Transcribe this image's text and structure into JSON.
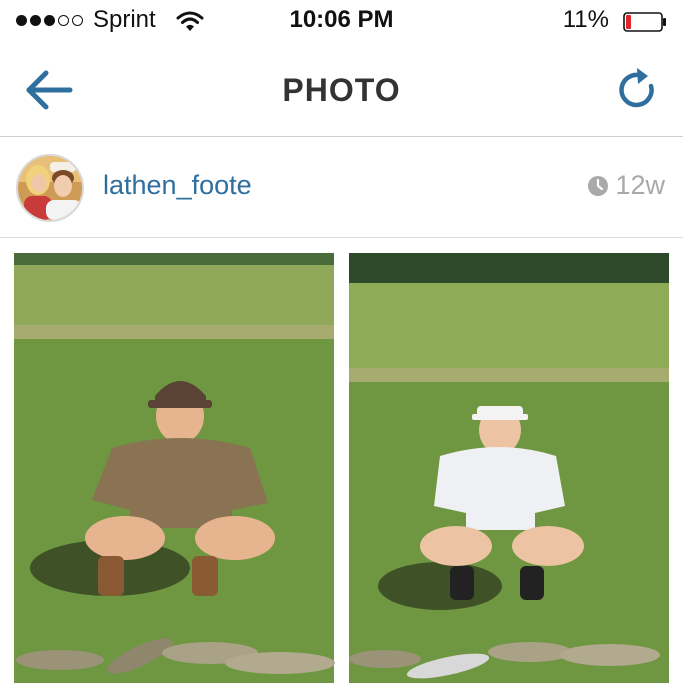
{
  "status_bar": {
    "carrier": "Sprint",
    "time": "10:06 PM",
    "battery_percent": "11%",
    "signal_bars_filled": 3,
    "signal_bars_total": 5,
    "battery_level": 0.11,
    "battery_color": "#e0262b"
  },
  "header": {
    "title": "PHOTO",
    "back_icon": "arrow-left-icon",
    "refresh_icon": "refresh-icon",
    "accent_color": "#2e6f9e"
  },
  "post": {
    "username": "lathen_foote",
    "time_ago": "12w",
    "time_icon": "clock-icon",
    "username_color": "#2e6f9e"
  },
  "photo": {
    "panels": 2,
    "content": "two side-by-side outdoor photos"
  }
}
